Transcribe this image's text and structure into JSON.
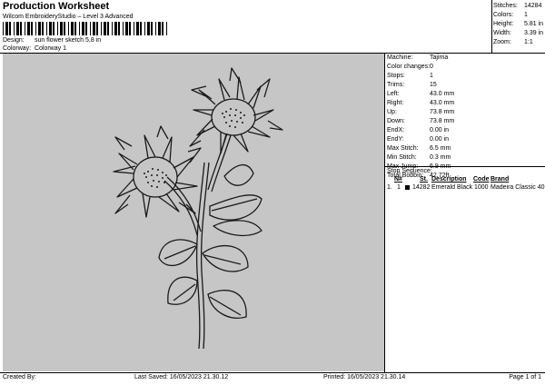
{
  "header": {
    "title": "Production Worksheet",
    "subtitle": "Wilcom EmbroideryStudio – Level 3 Advanced",
    "design_label": "Design:",
    "design_value": "sun flower sketch 5,8 in",
    "colorway_label": "Colorway:",
    "colorway_value": "Colorway 1"
  },
  "stats": [
    {
      "label": "Stitches:",
      "value": "14284"
    },
    {
      "label": "Colors:",
      "value": "1"
    },
    {
      "label": "Height:",
      "value": "5.81 in"
    },
    {
      "label": "Width:",
      "value": "3.39 in"
    },
    {
      "label": "Zoom:",
      "value": "1:1"
    }
  ],
  "params": [
    {
      "label": "Machine:",
      "value": "Tajima"
    },
    {
      "label": "Color changes:",
      "value": "0"
    },
    {
      "label": "Stops:",
      "value": "1"
    },
    {
      "label": "Trims:",
      "value": "15"
    },
    {
      "label": "Left:",
      "value": "43.0 mm"
    },
    {
      "label": "Right:",
      "value": "43.0 mm"
    },
    {
      "label": "Up:",
      "value": "73.8 mm"
    },
    {
      "label": "Down:",
      "value": "73.8 mm"
    },
    {
      "label": "EndX:",
      "value": "0.00 in"
    },
    {
      "label": "EndY:",
      "value": "0.00 in"
    },
    {
      "label": "Max Stitch:",
      "value": "6.5 mm"
    },
    {
      "label": "Min Stitch:",
      "value": "0.3 mm"
    },
    {
      "label": "Max Jump:",
      "value": "6.9 mm"
    },
    {
      "label": "Total Bobbin:",
      "value": "42.72ft"
    }
  ],
  "stop_sequence": {
    "title": "Stop Sequence:",
    "headers": {
      "n": "N#",
      "st": "St.",
      "description": "Description",
      "code": "Code",
      "brand": "Brand"
    },
    "rows": [
      {
        "index": "1.",
        "n": "1",
        "swatch": "#000000",
        "st": "14282",
        "description": "Emerald Black",
        "code": "1000",
        "brand": "Madeira Classic 40"
      }
    ]
  },
  "footer": {
    "created_by": "Created By:",
    "last_saved": "Last Saved: 16/05/2023 21.30.12",
    "printed": "Printed: 16/05/2023 21.30.14",
    "page": "Page 1 of 1"
  },
  "colors": {
    "canvas": "#c6c6c6",
    "thread": "#1a1a1a"
  }
}
